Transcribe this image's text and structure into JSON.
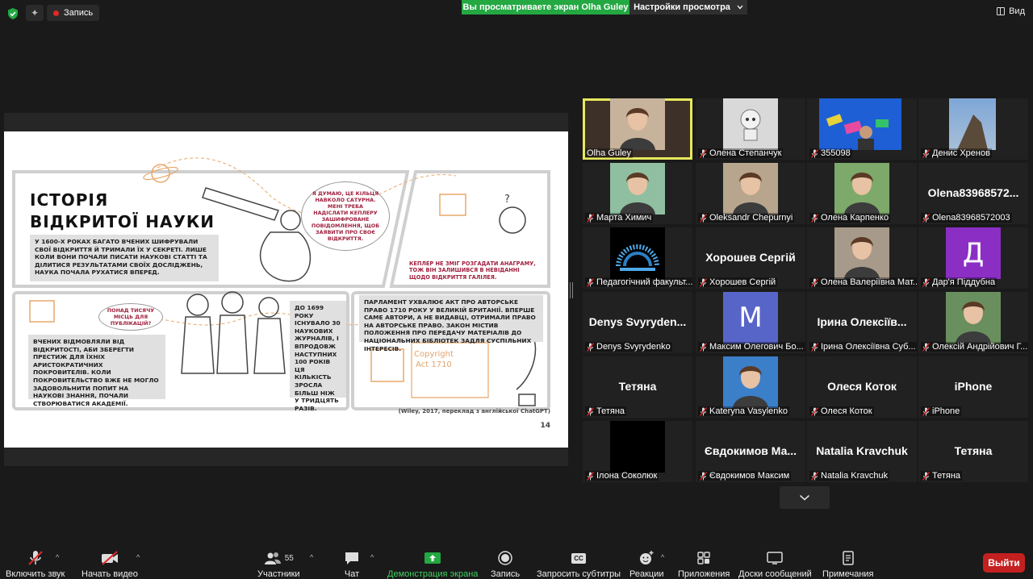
{
  "topbar": {
    "record_label": "Запись",
    "viewing_banner": "Вы просматриваете экран Olha Guley",
    "view_options_label": "Настройки просмотра",
    "view_label": "Вид"
  },
  "slide": {
    "title_line1": "ІСТОРІЯ",
    "title_line2": "ВІДКРИТОЇ НАУКИ",
    "intro": "У 1600-Х РОКАХ БАГАТО ВЧЕНИХ ШИФРУВАЛИ СВОЇ ВІДКРИТТЯ Й ТРИМАЛИ ЇХ У СЕКРЕТІ. ЛИШЕ КОЛИ ВОНИ ПОЧАЛИ ПИСАТИ НАУКОВІ СТАТТІ ТА ДІЛИТИСЯ РЕЗУЛЬТАТАМИ СВОЇХ ДОСЛІДЖЕНЬ, НАУКА ПОЧАЛА РУХАТИСЯ ВПЕРЕД.",
    "bubble_galileo": "Я ДУМАЮ, ЦЕ КІЛЬЦЯ НАВКОЛО САТУРНА. МЕНІ ТРЕБА НАДІСЛАТИ КЕПЛЕРУ ЗАШИФРОВАНЕ ПОВІДОМЛЕННЯ, ЩОБ ЗАЯВИТИ ПРО СВОЄ ВІДКРИТТЯ.",
    "kepler_text": "КЕПЛЕР НЕ ЗМІГ РОЗГАДАТИ АНАГРАМУ, ТОЖ ВІН ЗАЛИШИВСЯ В НЕВІДАННІ ЩОДО ВІДКРИТТЯ ГАЛІЛЕЯ.",
    "bubble_publications": "ПОНАД ТИСЯЧУ МІСЦЬ ДЛЯ ПУБЛІКАЦІЙ?",
    "patrons_text": "ВЧЕНИХ ВІДМОВЛЯЛИ ВІД ВІДКРИТОСТІ, АБИ ЗБЕРЕГТИ ПРЕСТИЖ ДЛЯ ЇХНІХ АРИСТОКРАТИЧНИХ ПОКРОВИТЕЛІВ. КОЛИ ПОКРОВИТЕЛЬСТВО ВЖЕ НЕ МОГЛО ЗАДОВОЛЬНИТИ ПОПИТ НА НАУКОВІ ЗНАННЯ, ПОЧАЛИ СТВОРЮВАТИСЯ АКАДЕМІЇ.",
    "journals_text": "ДО 1699 РОКУ ІСНУВАЛО 30 НАУКОВИХ ЖУРНАЛІВ, І ВПРОДОВЖ НАСТУПНИХ 100 РОКІВ ЦЯ КІЛЬКІСТЬ ЗРОСЛА БІЛЬШ НІЖ У ТРИДЦЯТЬ РАЗІВ.",
    "parliament_text": "ПАРЛАМЕНТ УХВАЛЮЄ АКТ ПРО АВТОРСЬКЕ ПРАВО 1710 РОКУ У ВЕЛИКІЙ БРИТАНІЇ. ВПЕРШЕ САМЕ АВТОРИ, А НЕ ВИДАВЦІ, ОТРИМАЛИ ПРАВО НА АВТОРСЬКЕ ПРАВО. ЗАКОН МІСТИВ ПОЛОЖЕННЯ ПРО ПЕРЕДАЧУ МАТЕРІАЛІВ ДО НАЦІОНАЛЬНИХ БІБЛІОТЕК ЗАДЛЯ СУСПІЛЬНИХ ІНТЕРЕСІВ.",
    "copyright_line1": "Copyright",
    "copyright_line2": "Act 1710",
    "credit": "(Wiley, 2017, переклад з англійської ChatGPT)",
    "page_number": "14"
  },
  "participants": [
    {
      "label": "Olha Guley",
      "big": "",
      "muted": false,
      "active": true,
      "photo": "person",
      "bg": "#c7b39b"
    },
    {
      "label": "Олена Степанчук",
      "big": "",
      "muted": true,
      "active": false,
      "photo": "robot",
      "bg": "#d9d9d9"
    },
    {
      "label": "355098",
      "big": "",
      "muted": true,
      "active": false,
      "photo": "blue",
      "bg": "#1e5fd6"
    },
    {
      "label": "Денис Хренов",
      "big": "",
      "muted": true,
      "active": false,
      "photo": "sky",
      "bg": "#6e8fb5"
    },
    {
      "label": "Марта Химич",
      "big": "",
      "muted": true,
      "active": false,
      "photo": "person",
      "bg": "#8fbfa0"
    },
    {
      "label": "Oleksandr Chepurnyi",
      "big": "",
      "muted": true,
      "active": false,
      "photo": "person",
      "bg": "#b7a58d"
    },
    {
      "label": "Олена Карпенко",
      "big": "",
      "muted": true,
      "active": false,
      "photo": "person",
      "bg": "#7da96a"
    },
    {
      "label": "Olena83968572003",
      "big": "Olena83968572...",
      "muted": true,
      "active": false,
      "photo": "",
      "bg": ""
    },
    {
      "label": "Педагогічний факульт...",
      "big": "",
      "muted": true,
      "active": false,
      "photo": "logo",
      "bg": "#000000"
    },
    {
      "label": "Хорошев Сергій",
      "big": "Хорошев Сергій",
      "muted": true,
      "active": false,
      "photo": "",
      "bg": ""
    },
    {
      "label": "Олена Валеріївна Мат...",
      "big": "",
      "muted": true,
      "active": false,
      "photo": "person",
      "bg": "#a89a8a"
    },
    {
      "label": "Дар'я Піддубна",
      "big": "",
      "muted": true,
      "active": false,
      "photo": "letter",
      "letter": "Д",
      "bg": "#8b2ec4"
    },
    {
      "label": "Denys Svyrydenko",
      "big": "Denys Svyryden...",
      "muted": true,
      "active": false,
      "photo": "",
      "bg": ""
    },
    {
      "label": "Максим Олегович Бо...",
      "big": "",
      "muted": true,
      "active": false,
      "photo": "letter",
      "letter": "M",
      "bg": "#5865c8"
    },
    {
      "label": "Ірина Олексіївна Суб...",
      "big": "Ірина Олексіїв...",
      "muted": true,
      "active": false,
      "photo": "",
      "bg": ""
    },
    {
      "label": "Олексій Андрійович Г...",
      "big": "",
      "muted": true,
      "active": false,
      "photo": "person",
      "bg": "#6a8f5e"
    },
    {
      "label": "Тетяна",
      "big": "Тетяна",
      "muted": true,
      "active": false,
      "photo": "",
      "bg": ""
    },
    {
      "label": "Kateryna Vasylenko",
      "big": "",
      "muted": true,
      "active": false,
      "photo": "person",
      "bg": "#3b7fc9"
    },
    {
      "label": "Олеся Коток",
      "big": "Олеся Коток",
      "muted": true,
      "active": false,
      "photo": "",
      "bg": ""
    },
    {
      "label": "iPhone",
      "big": "iPhone",
      "muted": true,
      "active": false,
      "photo": "",
      "bg": ""
    },
    {
      "label": "Ілона Соколюк",
      "big": "",
      "muted": true,
      "active": false,
      "photo": "black",
      "bg": "#000000"
    },
    {
      "label": "Євдокимов Максим",
      "big": "Євдокимов Ма...",
      "muted": true,
      "active": false,
      "photo": "",
      "bg": ""
    },
    {
      "label": "Natalia Kravchuk",
      "big": "Natalia Kravchuk",
      "muted": true,
      "active": false,
      "photo": "",
      "bg": ""
    },
    {
      "label": "Тетяна",
      "big": "Тетяна",
      "muted": true,
      "active": false,
      "photo": "",
      "bg": ""
    }
  ],
  "toolbar": {
    "mute_label": "Включить звук",
    "video_label": "Начать видео",
    "participants_label": "Участники",
    "participants_count": "55",
    "chat_label": "Чат",
    "share_label": "Демонстрация экрана",
    "record_label": "Запись",
    "captions_label": "Запросить субтитры",
    "reactions_label": "Реакции",
    "apps_label": "Приложения",
    "whiteboards_label": "Доски сообщений",
    "notes_label": "Примечания",
    "leave_label": "Выйти",
    "captions_icon_text": "CC"
  },
  "colors": {
    "share_green": "#23a842",
    "leave_red": "#c42020",
    "active_speaker": "#e6e85c",
    "slide_accent": "#a0203e"
  }
}
